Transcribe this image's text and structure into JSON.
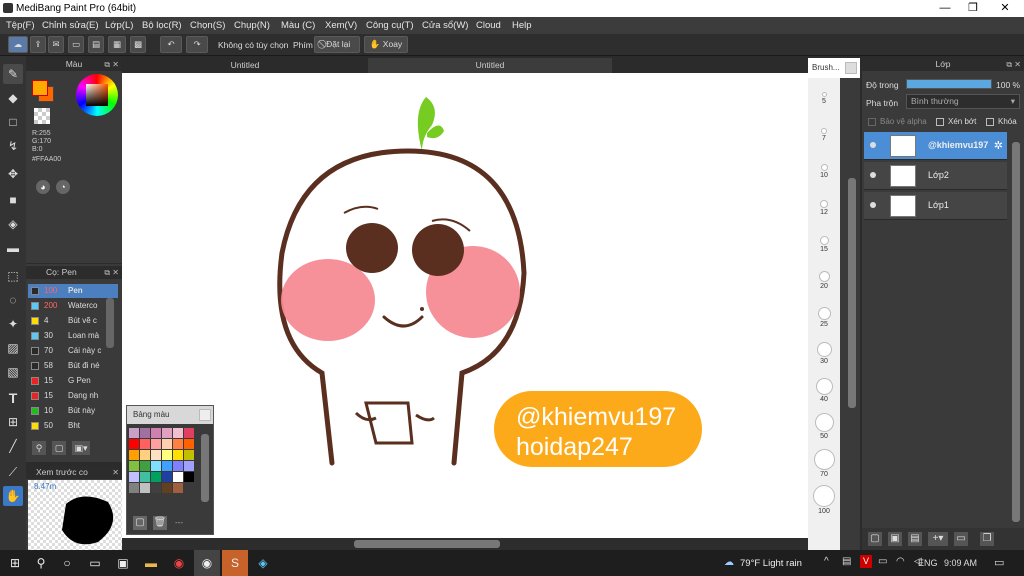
{
  "window": {
    "title": "MediBang Paint Pro (64bit)",
    "minimize": "—",
    "restore": "❐",
    "close": "✕"
  },
  "menu": [
    "Tệp(F)",
    "Chỉnh sửa(E)",
    "Lớp(L)",
    "Bộ lọc(R)",
    "Chọn(S)",
    "Chụp(N)",
    "Màu (C)",
    "Xem(V)",
    "Công cụ(T)",
    "Cửa sổ(W)",
    "Cloud",
    "Help"
  ],
  "toolbar": {
    "mode_label": "Không có tùy chọn",
    "snap_label": "Phím",
    "reset_label": "Đặt lại",
    "rotate_label": "Xoay"
  },
  "color_panel": {
    "title": "Màu",
    "r": "R:255",
    "g": "G:170",
    "b": "B:0",
    "hex": "#FFAA00",
    "accent": "#FFAA00"
  },
  "brush_panel": {
    "title": "Cọ: Pen",
    "items": [
      {
        "size": "100",
        "name": "Pen",
        "color": "#2a2a2a"
      },
      {
        "size": "200",
        "name": "Waterco",
        "color": "#5bc8f5"
      },
      {
        "size": "4",
        "name": "Bút vẽ c",
        "color": "#ffdd00"
      },
      {
        "size": "30",
        "name": "Loan mà",
        "color": "#5bc8f5"
      },
      {
        "size": "70",
        "name": "Cái này c",
        "color": "#2a2a2a"
      },
      {
        "size": "58",
        "name": "Bút đi né",
        "color": "#2a2a2a"
      },
      {
        "size": "15",
        "name": "G Pen",
        "color": "#ee2222"
      },
      {
        "size": "15",
        "name": "Dạng nh",
        "color": "#ee2222"
      },
      {
        "size": "10",
        "name": "Bút này",
        "color": "#22bb22"
      },
      {
        "size": "50",
        "name": "Bht",
        "color": "#ffdd00"
      }
    ]
  },
  "navigator": {
    "title": "Xem trước co",
    "zoom": "8.47m"
  },
  "tabs": [
    "Untitled",
    "Untitled"
  ],
  "palette": {
    "title": "Bảng màu",
    "more": "---"
  },
  "canvas": {
    "watermark_line1": "@khiemvu197",
    "watermark_line2": "hoidap247"
  },
  "brush_sizes": {
    "title": "Brush...",
    "sizes": [
      "5",
      "7",
      "10",
      "12",
      "15",
      "20",
      "25",
      "30",
      "40",
      "50",
      "70",
      "100"
    ]
  },
  "layers": {
    "title": "Lớp",
    "opacity_label": "Độ trong",
    "opacity_value": "100 %",
    "opacity": 1.0,
    "blend_label": "Pha trộn",
    "blend_value": "Bình thường",
    "protect_alpha": "Bảo vệ alpha",
    "clipping": "Xén bớt",
    "lock": "Khóa",
    "items": [
      {
        "name": "@khiemvu197",
        "selected": true
      },
      {
        "name": "Lớp2",
        "selected": false
      },
      {
        "name": "Lớp1",
        "selected": false
      }
    ]
  },
  "taskbar": {
    "weather": "79°F  Light rain",
    "language": "ENG",
    "time": "9:09 AM"
  }
}
